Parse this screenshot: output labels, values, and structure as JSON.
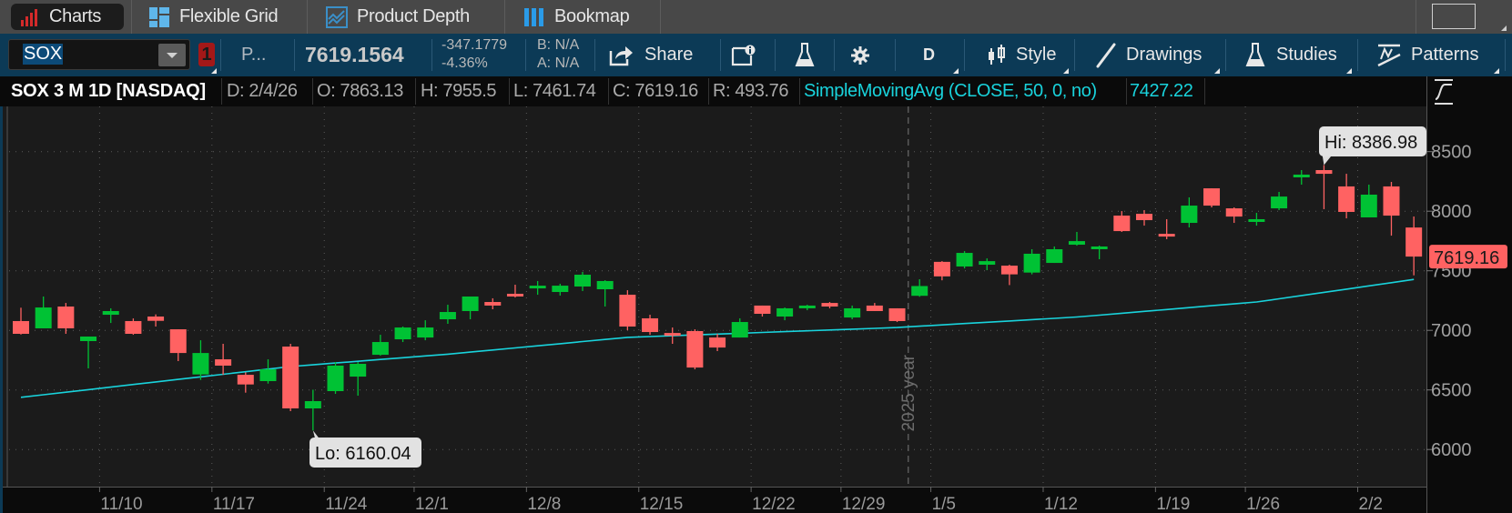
{
  "tabs": [
    {
      "label": "Charts",
      "active": true,
      "icon": "bar-chart-icon"
    },
    {
      "label": "Flexible Grid",
      "icon": "grid-icon"
    },
    {
      "label": "Product Depth",
      "icon": "depth-icon"
    },
    {
      "label": "Bookmap",
      "icon": "bookmap-icon"
    }
  ],
  "toolbar": {
    "symbol": "SOX",
    "link_badge": "1",
    "description": "P...",
    "last_price": "7619.1564",
    "net_change": "-347.1779",
    "pct_change": "-4.36%",
    "bid": "B: N/A",
    "ask": "A: N/A",
    "share": "Share",
    "timeframe": "D",
    "style": "Style",
    "drawings": "Drawings",
    "studies": "Studies",
    "patterns": "Patterns"
  },
  "info": {
    "title": "SOX 3 M 1D [NASDAQ]",
    "date": "D: 2/4/26",
    "open": "O: 7863.13",
    "high": "H: 7955.5",
    "low": "L: 7461.74",
    "close": "C: 7619.16",
    "range": "R: 493.76",
    "study": "SimpleMovingAvg (CLOSE, 50, 0, no)",
    "study_value": "7427.22"
  },
  "colors": {
    "up": "#00c234",
    "down": "#ff6262",
    "sma": "#19d3dc",
    "background": "#1b1b1b",
    "accent": "#0c3a56"
  },
  "chart_data": {
    "type": "candlestick",
    "ylim": [
      5700,
      8750
    ],
    "y_ticks": [
      "8500",
      "8000",
      "7500",
      "7000",
      "6500",
      "6000"
    ],
    "x_ticks": [
      {
        "label": "11/10",
        "at": "11/10"
      },
      {
        "label": "11/17",
        "at": "11/17"
      },
      {
        "label": "11/24",
        "at": "11/24"
      },
      {
        "label": "12/1",
        "at": "12/1"
      },
      {
        "label": "12/8",
        "at": "12/8"
      },
      {
        "label": "12/15",
        "at": "12/15"
      },
      {
        "label": "12/22",
        "at": "12/22"
      },
      {
        "label": "12/29",
        "at": "12/29"
      },
      {
        "label": "1/5",
        "at": "1/5"
      },
      {
        "label": "1/12",
        "at": "1/12"
      },
      {
        "label": "1/19",
        "at": "1/20"
      },
      {
        "label": "1/26",
        "at": "1/26"
      },
      {
        "label": "2/2",
        "at": "2/2"
      }
    ],
    "grid": true,
    "year_marker": {
      "label": "2025 year",
      "after": "12/31"
    },
    "hi_label": "Hi: 8386.98",
    "lo_label": "Lo: 6160.04",
    "last_price_tag": "7619.16",
    "candles_columns": [
      "date",
      "open",
      "high",
      "low",
      "close"
    ],
    "candles": [
      [
        "11/4",
        7078,
        7190,
        6965,
        6971
      ],
      [
        "11/5",
        7017,
        7284,
        7017,
        7192
      ],
      [
        "11/6",
        7200,
        7230,
        6971,
        7017
      ],
      [
        "11/7",
        6910,
        6948,
        6681,
        6948
      ],
      [
        "11/10",
        7131,
        7185,
        7062,
        7162
      ],
      [
        "11/11",
        7078,
        7100,
        6963,
        6971
      ],
      [
        "11/12",
        7116,
        7134,
        7032,
        7080
      ],
      [
        "11/13",
        7009,
        7009,
        6742,
        6810
      ],
      [
        "11/14",
        6630,
        6917,
        6584,
        6810
      ],
      [
        "11/17",
        6757,
        6887,
        6627,
        6704
      ],
      [
        "11/18",
        6627,
        6648,
        6477,
        6546
      ],
      [
        "11/19",
        6574,
        6757,
        6553,
        6673
      ],
      [
        "11/20",
        6864,
        6887,
        6322,
        6345
      ],
      [
        "11/21",
        6345,
        6502,
        6160.04,
        6406
      ],
      [
        "11/24",
        6490,
        6734,
        6467,
        6704
      ],
      [
        "11/25",
        6612,
        6734,
        6452,
        6719
      ],
      [
        "11/26",
        6795,
        6963,
        6788,
        6902
      ],
      [
        "11/28",
        6925,
        7032,
        6902,
        7024
      ],
      [
        "12/1",
        6940,
        7085,
        6917,
        7024
      ],
      [
        "12/2",
        7093,
        7215,
        7055,
        7154
      ],
      [
        "12/3",
        7162,
        7284,
        7093,
        7284
      ],
      [
        "12/4",
        7238,
        7269,
        7177,
        7208
      ],
      [
        "12/5",
        7307,
        7383,
        7276,
        7292
      ],
      [
        "12/8",
        7353,
        7414,
        7299,
        7375
      ],
      [
        "12/9",
        7322,
        7391,
        7292,
        7375
      ],
      [
        "12/10",
        7368,
        7490,
        7330,
        7467
      ],
      [
        "12/11",
        7345,
        7421,
        7200,
        7414
      ],
      [
        "12/12",
        7299,
        7337,
        7001,
        7032
      ],
      [
        "12/15",
        7101,
        7131,
        6963,
        6986
      ],
      [
        "12/16",
        6978,
        7024,
        6887,
        6956
      ],
      [
        "12/17",
        6994,
        7009,
        6673,
        6688
      ],
      [
        "12/18",
        6940,
        6971,
        6826,
        6856
      ],
      [
        "12/19",
        6940,
        7101,
        6940,
        7070
      ],
      [
        "12/22",
        7208,
        7208,
        7116,
        7139
      ],
      [
        "12/23",
        7116,
        7192,
        7085,
        7185
      ],
      [
        "12/24",
        7185,
        7215,
        7169,
        7208
      ],
      [
        "12/26",
        7230,
        7238,
        7185,
        7200
      ],
      [
        "12/29",
        7108,
        7208,
        7093,
        7185
      ],
      [
        "12/30",
        7208,
        7230,
        7162,
        7162
      ],
      [
        "12/31",
        7185,
        7185,
        7070,
        7078
      ],
      [
        "1/2",
        7290,
        7429,
        7282,
        7372
      ],
      [
        "1/5",
        7575,
        7581,
        7420,
        7453
      ],
      [
        "1/6",
        7536,
        7665,
        7520,
        7650
      ],
      [
        "1/7",
        7551,
        7604,
        7505,
        7581
      ],
      [
        "1/8",
        7543,
        7551,
        7380,
        7470
      ],
      [
        "1/9",
        7485,
        7681,
        7470,
        7643
      ],
      [
        "1/12",
        7566,
        7704,
        7566,
        7681
      ],
      [
        "1/13",
        7719,
        7826,
        7711,
        7749
      ],
      [
        "1/14",
        7681,
        7711,
        7597,
        7704
      ],
      [
        "1/15",
        7963,
        8001,
        7826,
        7833
      ],
      [
        "1/16",
        7978,
        8009,
        7879,
        7925
      ],
      [
        "1/20",
        7810,
        7933,
        7765,
        7788
      ],
      [
        "1/21",
        7902,
        8116,
        7864,
        8047
      ],
      [
        "1/22",
        8192,
        8192,
        8032,
        8047
      ],
      [
        "1/23",
        8024,
        8032,
        7902,
        7955
      ],
      [
        "1/26",
        7910,
        7986,
        7879,
        7933
      ],
      [
        "1/27",
        8024,
        8162,
        8009,
        8123
      ],
      [
        "1/28",
        8284,
        8345,
        8223,
        8307
      ],
      [
        "1/29",
        8345,
        8386.98,
        8017,
        8314
      ],
      [
        "1/30",
        8208,
        8314,
        7940,
        7994
      ],
      [
        "2/2",
        7948,
        8223,
        7948,
        8139
      ],
      [
        "2/3",
        8208,
        8246,
        7795,
        7963
      ],
      [
        "2/4",
        7863.13,
        7955.5,
        7461.74,
        7619.16
      ]
    ],
    "sma_anchor_points": [
      [
        "11/4",
        6438
      ],
      [
        "11/20",
        6696
      ],
      [
        "12/2",
        6800
      ],
      [
        "12/12",
        6941
      ],
      [
        "12/31",
        7024
      ],
      [
        "1/13",
        7112
      ],
      [
        "1/26",
        7238
      ],
      [
        "2/4",
        7427.22
      ]
    ]
  }
}
